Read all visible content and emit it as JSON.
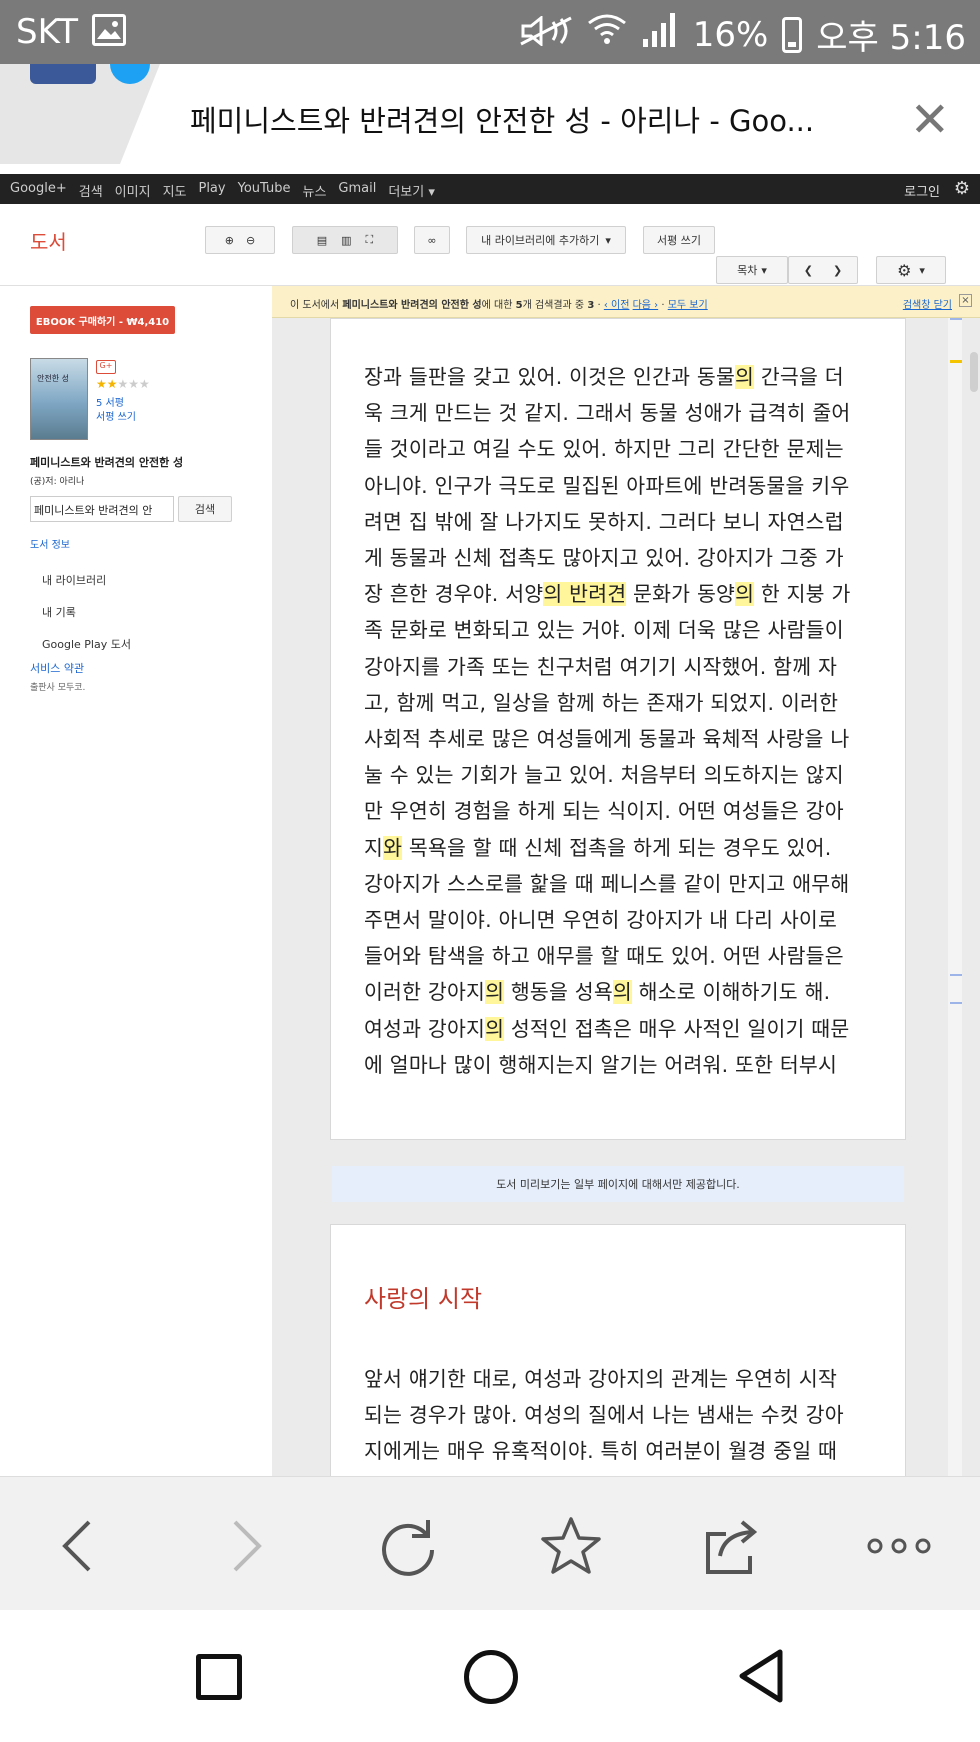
{
  "status_bar": {
    "carrier": "SKT",
    "battery": "16%",
    "time": "오후 5:16"
  },
  "browser": {
    "tab_title": "페미니스트와 반려견의 안전한 성 - 아리나 - Goo..."
  },
  "google_nav": {
    "items": [
      "Google+",
      "검색",
      "이미지",
      "지도",
      "Play",
      "YouTube",
      "뉴스",
      "Gmail",
      "더보기 ▾"
    ],
    "login": "로그인"
  },
  "books_header": {
    "brand": "도서",
    "add_library": "내 라이브러리에 추가하기",
    "write_review": "서평 쓰기",
    "toc": "목차"
  },
  "sidebar": {
    "buy_button": "EBOOK 구매하기 - ₩4,410",
    "cover_text": "안전한 성",
    "gplus": "G+",
    "reviews_count": "5 서평",
    "write_review": "서평 쓰기",
    "book_title": "페미니스트와 반려견의 안전한 성",
    "author": "(공)저: 아리나",
    "search_value": "페미니스트와 반려견의 안",
    "search_button": "검색",
    "book_info": "도서 정보",
    "my_library": "내 라이브러리",
    "my_history": "내 기록",
    "play_books": "Google Play 도서",
    "terms": "서비스 약관",
    "publisher": "출판사 모두코."
  },
  "search_bar": {
    "prefix": "이 도서에서",
    "query": "페미니스트와 반려견의 안전한 성",
    "mid": "에 대한",
    "count": "5",
    "suffix": "개 검색결과 중",
    "current": "3",
    "prev": "‹ 이전",
    "next": "다음 ›",
    "all": "모두 보기",
    "close": "검색창 닫기"
  },
  "page1_lines": [
    [
      "장과 들판을 갖고 있어. 이것은 인간과 동물",
      "의",
      " 간극을 더"
    ],
    [
      "욱 크게 만드는 것 같지. 그래서 동물 성애가 급격히 줄어"
    ],
    [
      "들 것이라고 여길 수도 있어. 하지만 그리 간단한 문제는"
    ],
    [
      "아니야. 인구가 극도로 밀집된 아파트에 반려동물을 키우"
    ],
    [
      "려면 집 밖에 잘 나가지도 못하지. 그러다 보니 자연스럽"
    ],
    [
      "게 동물과 신체 접촉도 많아지고 있어. 강아지가 그중 가"
    ],
    [
      "장 흔한 경우야. 서양",
      "의 반려견",
      " 문화가 동양",
      "의",
      " 한 지붕 가"
    ],
    [
      "족 문화로 변화되고 있는 거야. 이제 더욱 많은 사람들이"
    ],
    [
      "강아지를 가족 또는 친구처럼 여기기 시작했어. 함께 자"
    ],
    [
      "고, 함께 먹고, 일상을 함께 하는 존재가 되었지. 이러한"
    ],
    [
      "사회적 추세로 많은 여성들에게 동물과 육체적 사랑을 나"
    ],
    [
      "눌 수 있는 기회가 늘고 있어. 처음부터 의도하지는 않지"
    ],
    [
      "만 우연히 경험을 하게 되는 식이지. 어떤 여성들은 강아"
    ],
    [
      "지",
      "와",
      " 목욕을 할 때 신체 접촉을 하게 되는 경우도 있어."
    ],
    [
      "강아지가 스스로를 핥을 때 페니스를 같이 만지고 애무해"
    ],
    [
      "주면서 말이야. 아니면 우연히 강아지가 내 다리 사이로"
    ],
    [
      "들어와 탐색을 하고 애무를 할 때도 있어. 어떤 사람들은"
    ],
    [
      "이러한 강아지",
      "의",
      " 행동을 성욕",
      "의",
      " 해소로 이해하기도 해."
    ],
    [
      "여성과 강아지",
      "의",
      " 성적인 접촉은 매우 사적인 일이기 때문"
    ],
    [
      "에 얼마나 많이 행해지는지 알기는 어려워. 또한 터부시"
    ]
  ],
  "notice": "도서 미리보기는 일부 페이지에 대해서만 제공합니다.",
  "page2": {
    "chapter": "사랑의 시작",
    "lines": [
      "앞서 얘기한 대로, 여성과 강아지의 관계는 우연히 시작",
      "되는 경우가 많아. 여성의 질에서 나는 냄새는 수컷 강아",
      "지에게는 매우 유혹적이야. 특히 여러분이 월경 중일 때"
    ]
  }
}
